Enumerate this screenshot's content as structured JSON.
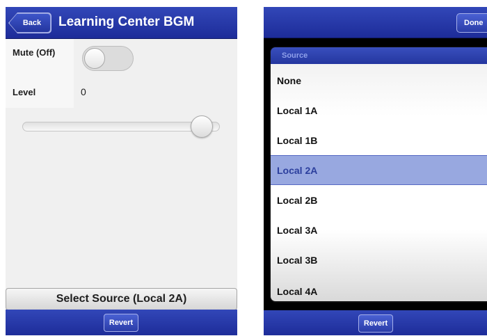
{
  "left": {
    "header": {
      "back_label": "Back",
      "title": "Learning Center BGM"
    },
    "mute": {
      "label": "Mute (Off)",
      "state": "off"
    },
    "level": {
      "label": "Level",
      "value": "0",
      "slider_fraction": 0.95
    },
    "select_source_label": "Select Source (Local 2A)",
    "footer": {
      "revert_label": "Revert"
    }
  },
  "right": {
    "header": {
      "done_label": "Done"
    },
    "picker": {
      "title": "Source",
      "options": [
        "None",
        "Local 1A",
        "Local 1B",
        "Local 2A",
        "Local 2B",
        "Local 3A",
        "Local 3B",
        "Local 4A"
      ],
      "selected": "Local 2A"
    },
    "footer": {
      "revert_label": "Revert"
    }
  },
  "colors": {
    "header_blue": "#2438a8",
    "selection": "#98a8e0"
  }
}
